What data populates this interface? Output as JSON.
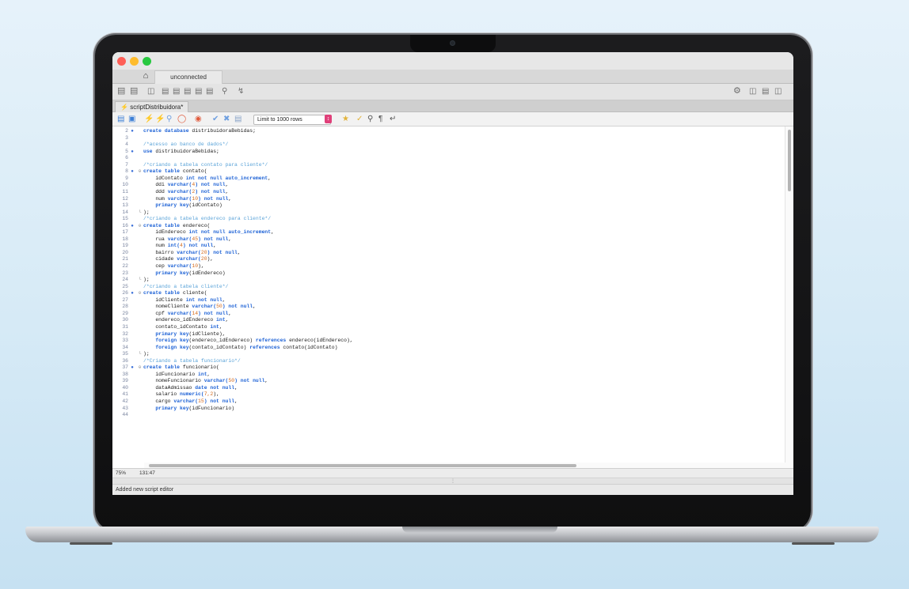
{
  "window": {
    "traffic_lights": [
      "#fe5f57",
      "#febc2e",
      "#28c840"
    ]
  },
  "tabs": {
    "home_icon": "home-icon",
    "connection_tab": "unconnected"
  },
  "file_tab": {
    "label": "scriptDistribuidora*",
    "icon": "lightning-icon"
  },
  "toolbar": {
    "limit_label": "Limit to 1000 rows"
  },
  "editor": {
    "lines": [
      {
        "n": "2",
        "mark": "●",
        "fold": "",
        "code": [
          {
            "t": "create database ",
            "c": "kw"
          },
          {
            "t": "distribuidoraBebidas;",
            "c": ""
          }
        ]
      },
      {
        "n": "3",
        "mark": "",
        "fold": "",
        "code": []
      },
      {
        "n": "4",
        "mark": "",
        "fold": "",
        "code": [
          {
            "t": "/*acesso ao banco de dados*/",
            "c": "cm"
          }
        ]
      },
      {
        "n": "5",
        "mark": "●",
        "fold": "",
        "code": [
          {
            "t": "use ",
            "c": "kw"
          },
          {
            "t": "distribuidoraBebidas;",
            "c": ""
          }
        ]
      },
      {
        "n": "6",
        "mark": "",
        "fold": "",
        "code": []
      },
      {
        "n": "7",
        "mark": "",
        "fold": "",
        "code": [
          {
            "t": "/*criando a tabela contato para cliente*/",
            "c": "cm"
          }
        ]
      },
      {
        "n": "8",
        "mark": "●",
        "fold": "⊖",
        "code": [
          {
            "t": "create table ",
            "c": "kw"
          },
          {
            "t": "contato(",
            "c": ""
          }
        ]
      },
      {
        "n": "9",
        "mark": "",
        "fold": "",
        "code": [
          {
            "t": "    idContato ",
            "c": ""
          },
          {
            "t": "int not null auto_increment",
            "c": "kw"
          },
          {
            "t": ",",
            "c": ""
          }
        ]
      },
      {
        "n": "10",
        "mark": "",
        "fold": "",
        "code": [
          {
            "t": "    ddi ",
            "c": ""
          },
          {
            "t": "varchar(",
            "c": "kw"
          },
          {
            "t": "4",
            "c": "num"
          },
          {
            "t": ") not null",
            "c": "kw"
          },
          {
            "t": ",",
            "c": ""
          }
        ]
      },
      {
        "n": "11",
        "mark": "",
        "fold": "",
        "code": [
          {
            "t": "    ddd ",
            "c": ""
          },
          {
            "t": "varchar(",
            "c": "kw"
          },
          {
            "t": "2",
            "c": "num"
          },
          {
            "t": ") not null",
            "c": "kw"
          },
          {
            "t": ",",
            "c": ""
          }
        ]
      },
      {
        "n": "12",
        "mark": "",
        "fold": "",
        "code": [
          {
            "t": "    num ",
            "c": ""
          },
          {
            "t": "varchar(",
            "c": "kw"
          },
          {
            "t": "10",
            "c": "num"
          },
          {
            "t": ") not null",
            "c": "kw"
          },
          {
            "t": ",",
            "c": ""
          }
        ]
      },
      {
        "n": "13",
        "mark": "",
        "fold": "",
        "code": [
          {
            "t": "    ",
            "c": ""
          },
          {
            "t": "primary key",
            "c": "kw"
          },
          {
            "t": "(idContato)",
            "c": ""
          }
        ]
      },
      {
        "n": "14",
        "mark": "",
        "fold": "└",
        "code": [
          {
            "t": ");",
            "c": ""
          }
        ]
      },
      {
        "n": "15",
        "mark": "",
        "fold": "",
        "code": [
          {
            "t": "/*criando a tabela endereco para cliente*/",
            "c": "cm"
          }
        ]
      },
      {
        "n": "16",
        "mark": "●",
        "fold": "⊖",
        "code": [
          {
            "t": "create table ",
            "c": "kw"
          },
          {
            "t": "endereco(",
            "c": ""
          }
        ]
      },
      {
        "n": "17",
        "mark": "",
        "fold": "",
        "code": [
          {
            "t": "    idEndereco ",
            "c": ""
          },
          {
            "t": "int not null auto_increment",
            "c": "kw"
          },
          {
            "t": ",",
            "c": ""
          }
        ]
      },
      {
        "n": "18",
        "mark": "",
        "fold": "",
        "code": [
          {
            "t": "    rua ",
            "c": ""
          },
          {
            "t": "varchar(",
            "c": "kw"
          },
          {
            "t": "45",
            "c": "num"
          },
          {
            "t": ") not null",
            "c": "kw"
          },
          {
            "t": ",",
            "c": ""
          }
        ]
      },
      {
        "n": "19",
        "mark": "",
        "fold": "",
        "code": [
          {
            "t": "    num ",
            "c": ""
          },
          {
            "t": "int(",
            "c": "kw"
          },
          {
            "t": "4",
            "c": "num"
          },
          {
            "t": ") not null",
            "c": "kw"
          },
          {
            "t": ",",
            "c": ""
          }
        ]
      },
      {
        "n": "20",
        "mark": "",
        "fold": "",
        "code": [
          {
            "t": "    bairro ",
            "c": ""
          },
          {
            "t": "varchar(",
            "c": "kw"
          },
          {
            "t": "20",
            "c": "num"
          },
          {
            "t": ") not null",
            "c": "kw"
          },
          {
            "t": ",",
            "c": ""
          }
        ]
      },
      {
        "n": "21",
        "mark": "",
        "fold": "",
        "code": [
          {
            "t": "    cidade ",
            "c": ""
          },
          {
            "t": "varchar(",
            "c": "kw"
          },
          {
            "t": "20",
            "c": "num"
          },
          {
            "t": "),",
            "c": ""
          }
        ]
      },
      {
        "n": "22",
        "mark": "",
        "fold": "",
        "code": [
          {
            "t": "    cep ",
            "c": ""
          },
          {
            "t": "varchar(",
            "c": "kw"
          },
          {
            "t": "10",
            "c": "num"
          },
          {
            "t": "),",
            "c": ""
          }
        ]
      },
      {
        "n": "23",
        "mark": "",
        "fold": "",
        "code": [
          {
            "t": "    ",
            "c": ""
          },
          {
            "t": "primary key",
            "c": "kw"
          },
          {
            "t": "(idEndereco)",
            "c": ""
          }
        ]
      },
      {
        "n": "24",
        "mark": "",
        "fold": "└",
        "code": [
          {
            "t": ");",
            "c": ""
          }
        ]
      },
      {
        "n": "25",
        "mark": "",
        "fold": "",
        "code": [
          {
            "t": "/*criando a tabela cliente*/",
            "c": "cm"
          }
        ]
      },
      {
        "n": "26",
        "mark": "●",
        "fold": "⊖",
        "code": [
          {
            "t": "create table ",
            "c": "kw"
          },
          {
            "t": "cliente(",
            "c": ""
          }
        ]
      },
      {
        "n": "27",
        "mark": "",
        "fold": "",
        "code": [
          {
            "t": "    idCliente ",
            "c": ""
          },
          {
            "t": "int not null",
            "c": "kw"
          },
          {
            "t": ",",
            "c": ""
          }
        ]
      },
      {
        "n": "28",
        "mark": "",
        "fold": "",
        "code": [
          {
            "t": "    nomeCliente ",
            "c": ""
          },
          {
            "t": "varchar(",
            "c": "kw"
          },
          {
            "t": "50",
            "c": "num"
          },
          {
            "t": ") not null",
            "c": "kw"
          },
          {
            "t": ",",
            "c": ""
          }
        ]
      },
      {
        "n": "29",
        "mark": "",
        "fold": "",
        "code": [
          {
            "t": "    cpf ",
            "c": ""
          },
          {
            "t": "varchar(",
            "c": "kw"
          },
          {
            "t": "14",
            "c": "num"
          },
          {
            "t": ") not null",
            "c": "kw"
          },
          {
            "t": ",",
            "c": ""
          }
        ]
      },
      {
        "n": "30",
        "mark": "",
        "fold": "",
        "code": [
          {
            "t": "    endereco_idEndereco ",
            "c": ""
          },
          {
            "t": "int",
            "c": "kw"
          },
          {
            "t": ",",
            "c": ""
          }
        ]
      },
      {
        "n": "31",
        "mark": "",
        "fold": "",
        "code": [
          {
            "t": "    contato_idContato ",
            "c": ""
          },
          {
            "t": "int",
            "c": "kw"
          },
          {
            "t": ",",
            "c": ""
          }
        ]
      },
      {
        "n": "32",
        "mark": "",
        "fold": "",
        "code": [
          {
            "t": "    ",
            "c": ""
          },
          {
            "t": "primary key",
            "c": "kw"
          },
          {
            "t": "(idCliente),",
            "c": ""
          }
        ]
      },
      {
        "n": "33",
        "mark": "",
        "fold": "",
        "code": [
          {
            "t": "    ",
            "c": ""
          },
          {
            "t": "foreign key",
            "c": "kw"
          },
          {
            "t": "(endereco_idEndereco) ",
            "c": ""
          },
          {
            "t": "references ",
            "c": "kw"
          },
          {
            "t": "endereco(idEndereco),",
            "c": ""
          }
        ]
      },
      {
        "n": "34",
        "mark": "",
        "fold": "",
        "code": [
          {
            "t": "    ",
            "c": ""
          },
          {
            "t": "foreign key",
            "c": "kw"
          },
          {
            "t": "(contato_idContato) ",
            "c": ""
          },
          {
            "t": "references ",
            "c": "kw"
          },
          {
            "t": "contato(idContato)",
            "c": ""
          }
        ]
      },
      {
        "n": "35",
        "mark": "",
        "fold": "└",
        "code": [
          {
            "t": ");",
            "c": ""
          }
        ]
      },
      {
        "n": "36",
        "mark": "",
        "fold": "",
        "code": [
          {
            "t": "/*Criando a tabela funcionario*/",
            "c": "cm"
          }
        ]
      },
      {
        "n": "37",
        "mark": "●",
        "fold": "⊖",
        "code": [
          {
            "t": "create table ",
            "c": "kw"
          },
          {
            "t": "funcionario(",
            "c": ""
          }
        ]
      },
      {
        "n": "38",
        "mark": "",
        "fold": "",
        "code": [
          {
            "t": "    idFuncionario ",
            "c": ""
          },
          {
            "t": "int",
            "c": "kw"
          },
          {
            "t": ",",
            "c": ""
          }
        ]
      },
      {
        "n": "39",
        "mark": "",
        "fold": "",
        "code": [
          {
            "t": "    nomeFuncionario ",
            "c": ""
          },
          {
            "t": "varchar(",
            "c": "kw"
          },
          {
            "t": "50",
            "c": "num"
          },
          {
            "t": ") not null",
            "c": "kw"
          },
          {
            "t": ",",
            "c": ""
          }
        ]
      },
      {
        "n": "40",
        "mark": "",
        "fold": "",
        "code": [
          {
            "t": "    dataAdmissao ",
            "c": ""
          },
          {
            "t": "date not null",
            "c": "kw"
          },
          {
            "t": ",",
            "c": ""
          }
        ]
      },
      {
        "n": "41",
        "mark": "",
        "fold": "",
        "code": [
          {
            "t": "    salario ",
            "c": ""
          },
          {
            "t": "numeric(",
            "c": "kw"
          },
          {
            "t": "7,2",
            "c": "num"
          },
          {
            "t": "),",
            "c": ""
          }
        ]
      },
      {
        "n": "42",
        "mark": "",
        "fold": "",
        "code": [
          {
            "t": "    cargo ",
            "c": ""
          },
          {
            "t": "varchar(",
            "c": "kw"
          },
          {
            "t": "15",
            "c": "num"
          },
          {
            "t": ") not null",
            "c": "kw"
          },
          {
            "t": ",",
            "c": ""
          }
        ]
      },
      {
        "n": "43",
        "mark": "",
        "fold": "",
        "code": [
          {
            "t": "    ",
            "c": ""
          },
          {
            "t": "primary key",
            "c": "kw"
          },
          {
            "t": "(idFuncionario)",
            "c": ""
          }
        ]
      },
      {
        "n": "44",
        "mark": "",
        "fold": "",
        "code": []
      }
    ]
  },
  "status": {
    "zoom": "75%",
    "cursor": "131:47"
  },
  "statusbar": {
    "message": "Added new script editor"
  }
}
